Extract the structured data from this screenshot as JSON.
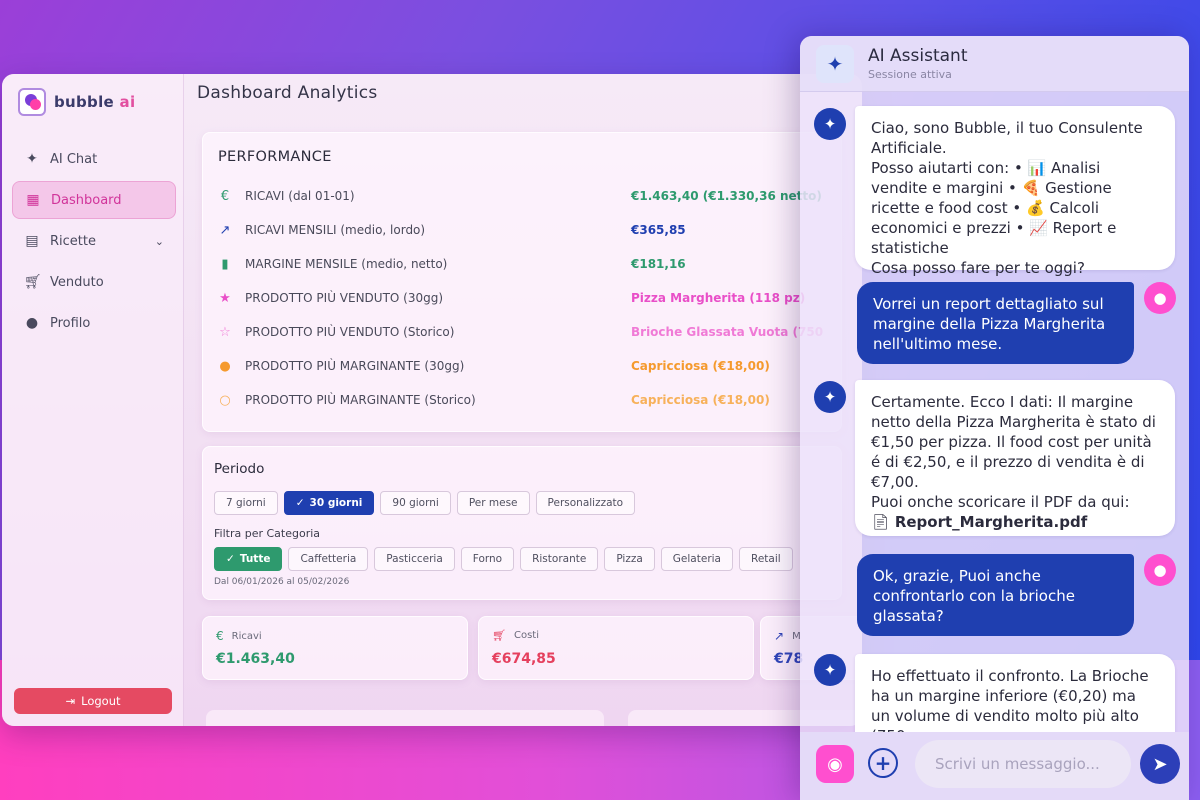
{
  "brand": {
    "name": "bubble",
    "suffix": "ai"
  },
  "sidebar": {
    "items": [
      {
        "label": "AI Chat",
        "icon": "sparkle-icon"
      },
      {
        "label": "Dashboard",
        "icon": "dashboard-icon",
        "active": true
      },
      {
        "label": "Ricette",
        "icon": "book-icon"
      },
      {
        "label": "Venduto",
        "icon": "cart-icon"
      },
      {
        "label": "Profilo",
        "icon": "person-icon"
      }
    ],
    "logout": "Logout"
  },
  "main": {
    "title": "Dashboard Analytics",
    "performance": {
      "title": "PERFORMANCE",
      "rows": [
        {
          "label": "RICAVI (dal 01-01)",
          "value": "€1.463,40 (€1.330,36 netto)",
          "color": "#2e9a6e",
          "icon": "euro-icon"
        },
        {
          "label": "RICAVI MENSILI (medio, lordo)",
          "value": "€365,85",
          "color": "#1f3fb0",
          "icon": "trend-up-icon"
        },
        {
          "label": "MARGINE MENSILE (medio, netto)",
          "value": "€181,16",
          "color": "#2e9a6e",
          "icon": "bar-chart-icon"
        },
        {
          "label": "PRODOTTO PIÙ VENDUTO (30gg)",
          "value": "Pizza Margherita (118 pz)",
          "color": "#e94fc8",
          "icon": "star-filled-icon"
        },
        {
          "label": "PRODOTTO PIÙ VENDUTO (Storico)",
          "value": "Brioche Glassata Vuota (750",
          "color": "#f07ad6",
          "icon": "star-outline-icon"
        },
        {
          "label": "PRODOTTO PIÙ MARGINANTE (30gg)",
          "value": "Capricciosa (€18,00)",
          "color": "#f59a2e",
          "icon": "coin-icon"
        },
        {
          "label": "PRODOTTO PIÙ MARGINANTE (Storico)",
          "value": "Capricciosa (€18,00)",
          "color": "#f7b15a",
          "icon": "coin-outline-icon"
        }
      ]
    },
    "period": {
      "title": "Periodo",
      "options": [
        "7 giorni",
        "30 giorni",
        "90 giorni",
        "Per mese",
        "Personalizzato"
      ],
      "selected": "30 giorni",
      "filter_label": "Filtra per Categoria",
      "categories": [
        "Tutte",
        "Caffetteria",
        "Pasticceria",
        "Forno",
        "Ristorante",
        "Pizza",
        "Gelateria",
        "Retail"
      ],
      "selected_category": "Tutte",
      "date_range": "Dal 06/01/2026 al 05/02/2026"
    },
    "stats": [
      {
        "label": "Ricavi",
        "value": "€1.463,40",
        "color": "#2e9a6e",
        "icon": "euro-icon"
      },
      {
        "label": "Costi",
        "value": "€674,85",
        "color": "#e5405e",
        "icon": "cart-icon"
      },
      {
        "label": "M",
        "value": "€78",
        "color": "#2f45b8",
        "icon": "trend-up-icon"
      }
    ]
  },
  "chat": {
    "title": "AI Assistant",
    "subtitle": "Sessione attiva",
    "messages": [
      {
        "role": "bot",
        "text": "Ciao, sono Bubble, il tuo Consulente Artificiale.\nPosso aiutarti con: • 📊 Analisi vendite e margini • 🍕 Gestione ricette e food cost • 💰 Calcoli economici e prezzi • 📈 Report e statistiche\nCosa posso fare per te oggi?"
      },
      {
        "role": "user",
        "text": "Vorrei un report dettagliato sul margine della Pizza Margherita nell'ultimo mese."
      },
      {
        "role": "bot",
        "text": "Certamente. Ecco I dati: Il margine netto della Pizza Margherita è stato di €1,50 per pizza. Il food cost per unità é di €2,50, e il prezzo di vendita è di €7,00.\nPuoi onche scoricare il PDF da qui:",
        "file": "Report_Margherita.pdf"
      },
      {
        "role": "user",
        "text": "Ok, grazie, Puoi anche confrontarlo con la brioche glassata?"
      },
      {
        "role": "bot",
        "text": "Ho effettuato il confronto. La Brioche ha un margine inferiore (€0,20) ma un volume di vendito molto più alto (750"
      }
    ],
    "input_placeholder": "Scrivi un messaggio..."
  }
}
